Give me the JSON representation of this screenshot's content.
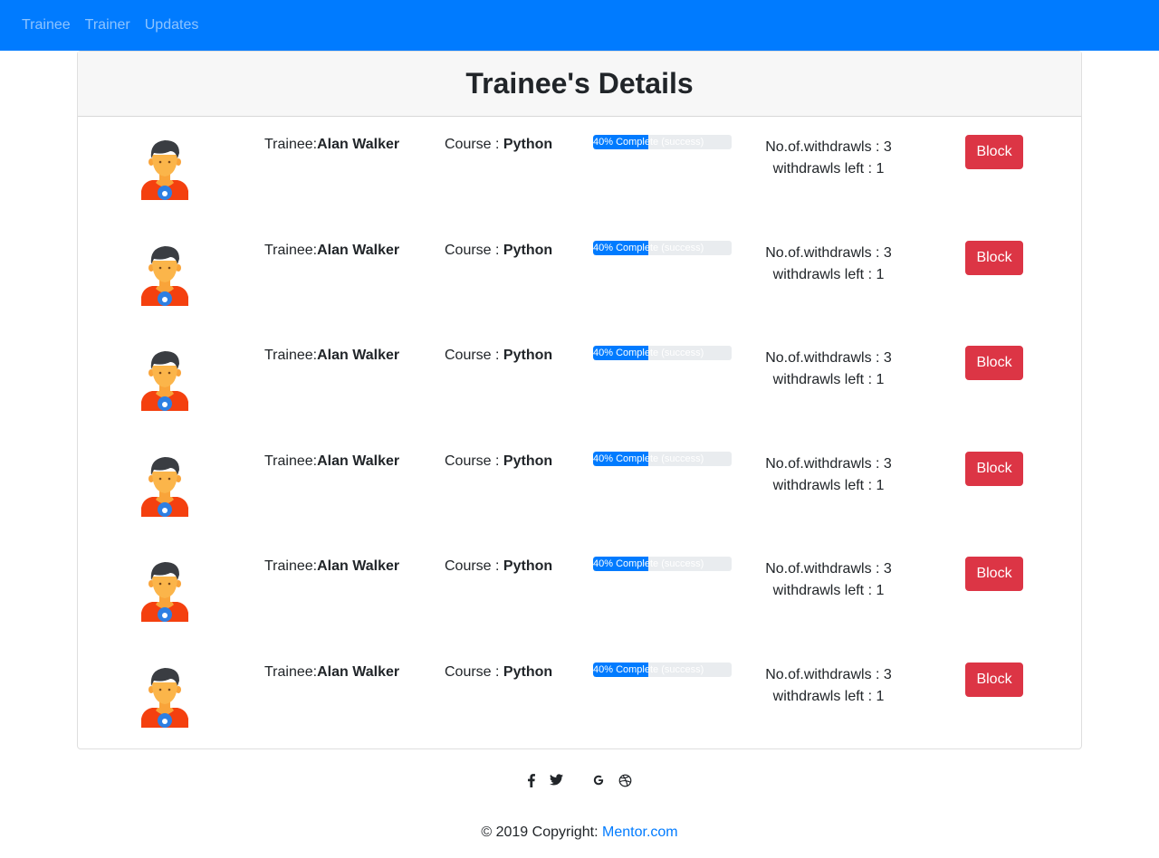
{
  "navbar": {
    "links": [
      "Trainee",
      "Trainer",
      "Updates"
    ],
    "background": "#007bff"
  },
  "card": {
    "title": "Trainee's Details"
  },
  "trainees": [
    {
      "trainee_prefix": "Trainee:",
      "name": "Alan Walker",
      "course_prefix": "Course : ",
      "course": "Python",
      "progress": 40,
      "progress_label": "40% Complete (success)",
      "withdrawls": "No.of.withdrawls : 3",
      "withdrawls_left": "withdrawls left : 1",
      "button": "Block",
      "avatar_icon": "user-avatar-icon"
    },
    {
      "trainee_prefix": "Trainee:",
      "name": "Alan Walker",
      "course_prefix": "Course : ",
      "course": "Python",
      "progress": 40,
      "progress_label": "40% Complete (success)",
      "withdrawls": "No.of.withdrawls : 3",
      "withdrawls_left": "withdrawls left : 1",
      "button": "Block",
      "avatar_icon": "user-avatar-icon"
    },
    {
      "trainee_prefix": "Trainee:",
      "name": "Alan Walker",
      "course_prefix": "Course : ",
      "course": "Python",
      "progress": 40,
      "progress_label": "40% Complete (success)",
      "withdrawls": "No.of.withdrawls : 3",
      "withdrawls_left": "withdrawls left : 1",
      "button": "Block",
      "avatar_icon": "user-avatar-icon"
    },
    {
      "trainee_prefix": "Trainee:",
      "name": "Alan Walker",
      "course_prefix": "Course : ",
      "course": "Python",
      "progress": 40,
      "progress_label": "40% Complete (success)",
      "withdrawls": "No.of.withdrawls : 3",
      "withdrawls_left": "withdrawls left : 1",
      "button": "Block",
      "avatar_icon": "user-avatar-icon"
    },
    {
      "trainee_prefix": "Trainee:",
      "name": "Alan Walker",
      "course_prefix": "Course : ",
      "course": "Python",
      "progress": 40,
      "progress_label": "40% Complete (success)",
      "withdrawls": "No.of.withdrawls : 3",
      "withdrawls_left": "withdrawls left : 1",
      "button": "Block",
      "avatar_icon": "user-avatar-icon"
    },
    {
      "trainee_prefix": "Trainee:",
      "name": "Alan Walker",
      "course_prefix": "Course : ",
      "course": "Python",
      "progress": 40,
      "progress_label": "40% Complete (success)",
      "withdrawls": "No.of.withdrawls : 3",
      "withdrawls_left": "withdrawls left : 1",
      "button": "Block",
      "avatar_icon": "user-avatar-icon"
    }
  ],
  "footer": {
    "social_icons": [
      "facebook-icon",
      "twitter-icon",
      "google-icon",
      "dribbble-icon"
    ],
    "copyright_prefix": "© 2019 Copyright:",
    "copyright_link": "Mentor.com"
  },
  "colors": {
    "primary": "#007bff",
    "danger": "#dc3545",
    "progress_track": "#e9ecef"
  }
}
